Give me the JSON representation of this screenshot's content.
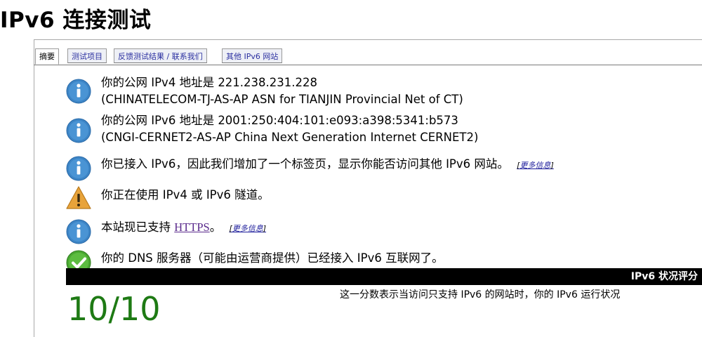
{
  "page_title": "IPv6 连接测试",
  "tabs": [
    {
      "label": "摘要",
      "active": true
    },
    {
      "label": "测试项目",
      "active": false
    },
    {
      "label": "反馈测试结果 / 联系我们",
      "active": false
    },
    {
      "label": "其他 IPv6 网站",
      "active": false
    }
  ],
  "results": {
    "ipv4": {
      "icon": "info-icon",
      "line1": "你的公网 IPv4 地址是 221.238.231.228",
      "line2": "(CHINATELECOM-TJ-AS-AP ASN for TIANJIN Provincial Net of CT)"
    },
    "ipv6": {
      "icon": "info-icon",
      "line1": "你的公网 IPv6 地址是 2001:250:404:101:e093:a398:5341:b573",
      "line2": "(CNGI-CERNET2-AS-AP China Next Generation Internet CERNET2)"
    },
    "tab_added": {
      "icon": "info-icon",
      "text": "你已接入 IPv6，因此我们增加了一个标签页，显示你能否访问其他 IPv6 网站。",
      "more_label": "更多信息"
    },
    "tunnel": {
      "icon": "warning-icon",
      "text": "你正在使用 IPv4 或 IPv6 隧道。"
    },
    "https": {
      "icon": "info-icon",
      "text_before": "本站现已支持 ",
      "link_text": "HTTPS",
      "text_after": "。",
      "more_label": "更多信息"
    },
    "dns": {
      "icon": "check-icon",
      "text": "你的 DNS 服务器（可能由运营商提供）已经接入 IPv6 互联网了。"
    }
  },
  "score": {
    "header": "IPv6 状况评分",
    "value": "10/10",
    "description": "这一分数表示当访问只支持 IPv6 的网站时，你的 IPv6 运行状况"
  },
  "colors": {
    "info_icon": "#3d85c6",
    "warning_icon": "#e8a33a",
    "check_icon": "#4aa832",
    "score_text": "#1e7a14",
    "tab_link": "#2a2fa0"
  }
}
